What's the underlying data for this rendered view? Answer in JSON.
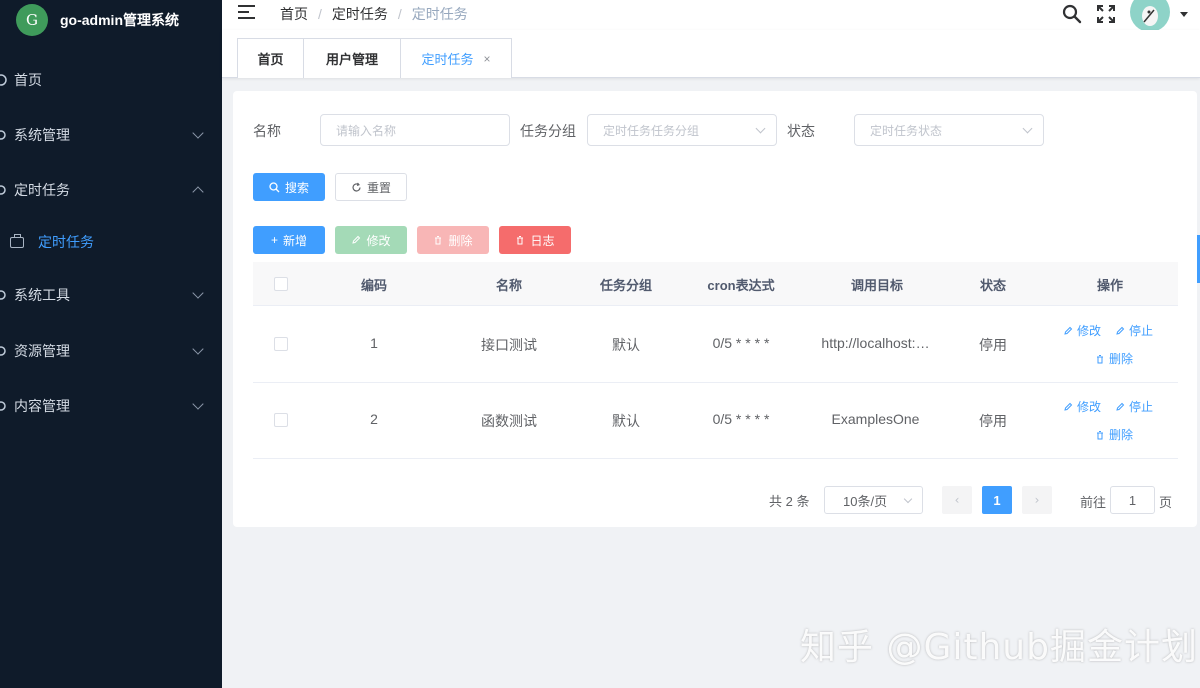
{
  "app": {
    "title": "go-admin管理系统",
    "logo_text": "G"
  },
  "sidebar": {
    "items": [
      {
        "label": "首页",
        "icon": "dashboard-icon"
      },
      {
        "label": "系统管理",
        "icon": "system-icon",
        "expanded": false
      },
      {
        "label": "定时任务",
        "icon": "clock-icon",
        "expanded": true
      },
      {
        "label": "定时任务",
        "icon": "briefcase-icon",
        "submenu": true,
        "active": true
      },
      {
        "label": "系统工具",
        "icon": "tool-icon",
        "expanded": false
      },
      {
        "label": "资源管理",
        "icon": "resource-icon",
        "expanded": false
      },
      {
        "label": "内容管理",
        "icon": "content-icon",
        "expanded": false
      }
    ]
  },
  "header": {
    "breadcrumb": [
      "首页",
      "定时任务",
      "定时任务"
    ]
  },
  "tags": [
    {
      "label": "首页"
    },
    {
      "label": "用户管理"
    },
    {
      "label": "定时任务",
      "active": true,
      "close": "×"
    }
  ],
  "filters": {
    "name_label": "名称",
    "name_placeholder": "请输入名称",
    "group_label": "任务分组",
    "group_placeholder": "定时任务任务分组",
    "status_label": "状态",
    "status_placeholder": "定时任务状态"
  },
  "buttons": {
    "search": "搜索",
    "reset": "重置",
    "add": "新增",
    "edit": "修改",
    "delete": "删除",
    "log": "日志"
  },
  "table": {
    "columns": [
      "编码",
      "名称",
      "任务分组",
      "cron表达式",
      "调用目标",
      "状态",
      "操作"
    ],
    "rows": [
      {
        "id": "1",
        "name": "接口测试",
        "group": "默认",
        "cron": "0/5 * * * *",
        "target": "http://localhost:…",
        "status": "停用"
      },
      {
        "id": "2",
        "name": "函数测试",
        "group": "默认",
        "cron": "0/5 * * * *",
        "target": "ExamplesOne",
        "status": "停用"
      }
    ],
    "ops": {
      "edit": "修改",
      "stop": "停止",
      "delete": "删除"
    }
  },
  "pagination": {
    "total": "共 2 条",
    "page_size": "10条/页",
    "current": "1",
    "goto_label": "前往",
    "goto_value": "1",
    "page_unit": "页"
  },
  "watermark": "知乎 @Github掘金计划",
  "colors": {
    "primary": "#409eff",
    "sidebar_bg": "#0f1b2a",
    "danger": "#f56c6c"
  }
}
